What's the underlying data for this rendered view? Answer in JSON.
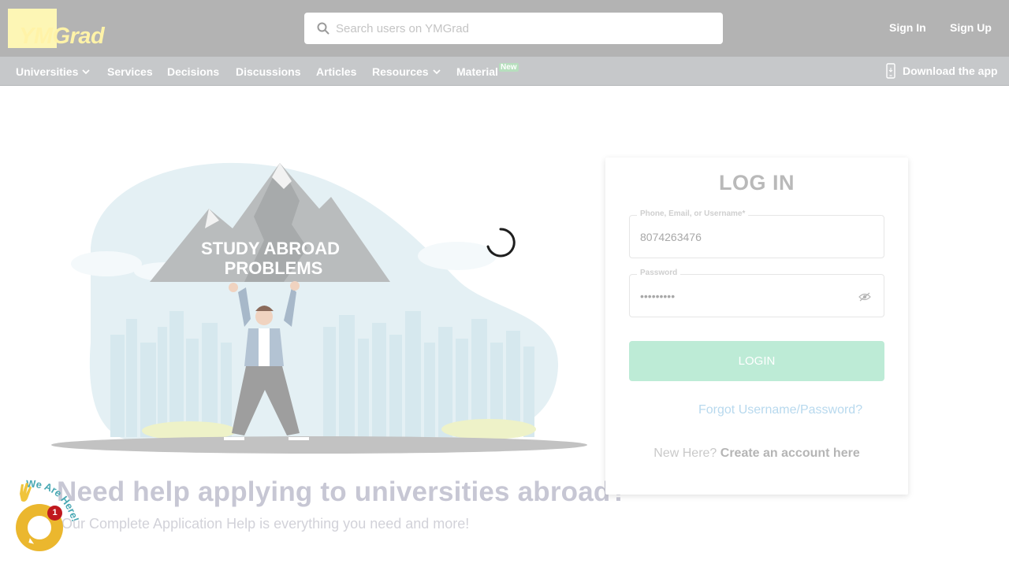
{
  "header": {
    "logo_text": "YMGrad",
    "search_placeholder": "Search users on YMGrad",
    "sign_in": "Sign In",
    "sign_up": "Sign Up"
  },
  "nav": {
    "items": [
      "Universities",
      "Services",
      "Decisions",
      "Discussions",
      "Articles",
      "Resources",
      "Material"
    ],
    "new_badge": "New",
    "download": "Download the app"
  },
  "hero": {
    "illustration_text_1": "STUDY ABROAD",
    "illustration_text_2": "PROBLEMS",
    "headline": "Need help applying to universities abroad?",
    "subline": "Our Complete Application Help is everything you need and more!"
  },
  "login": {
    "title": "LOG IN",
    "phone_label": "Phone, Email, or Username*",
    "phone_value": "8074263476",
    "password_label": "Password",
    "password_value": "•••••••••",
    "login_button": "LOGIN",
    "forgot": "Forgot Username/Password?",
    "new_here": "New Here?",
    "create_account": "Create an account here"
  },
  "chat": {
    "badge_count": "1",
    "wave_text": "We Are Here!"
  },
  "colors": {
    "topbar": "#b3b3b3",
    "navbar": "#c6c8ca",
    "login_button": "#bdebd6",
    "chat_bubble": "#ebb72e",
    "chat_badge": "#c0181e"
  },
  "icons": {
    "search": "search-icon",
    "chevron": "chevron-down-icon",
    "phone": "phone-icon",
    "eye": "eye-icon",
    "chat": "chat-icon",
    "wave": "waving-hand-icon",
    "spinner": "loading-spinner-icon"
  }
}
